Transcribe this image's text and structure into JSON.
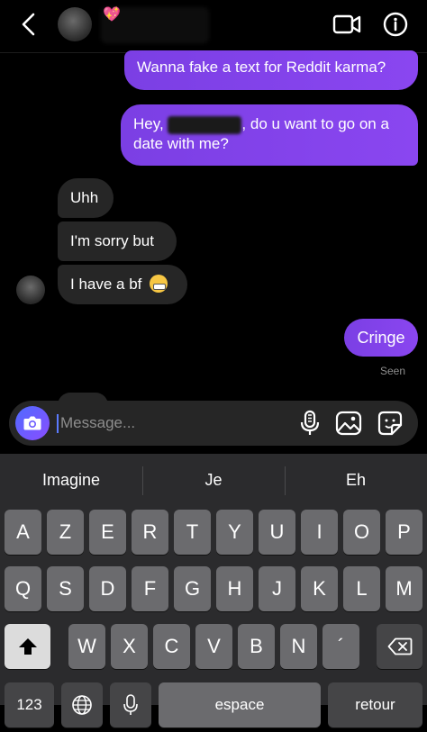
{
  "header": {
    "back_icon": "chevron-left-icon",
    "video_icon": "video-camera-icon",
    "info_icon": "info-icon"
  },
  "messages": [
    {
      "side": "sent",
      "text": "Wanna fake a text for Reddit karma?"
    },
    {
      "side": "sent",
      "text_before": "Hey, ",
      "text_after": ", do u want to go on a date with me?"
    },
    {
      "side": "received",
      "text": "Uhh"
    },
    {
      "side": "received",
      "text": "I'm sorry but"
    },
    {
      "side": "received",
      "text": "I have a bf",
      "emoji": "grimacing-face"
    },
    {
      "side": "sent",
      "text": "Cringe"
    }
  ],
  "seen_label": "Seen",
  "composer": {
    "placeholder": "Message...",
    "camera_icon": "camera-icon",
    "mic_icon": "microphone-icon",
    "gallery_icon": "image-icon",
    "sticker_icon": "sticker-icon"
  },
  "keyboard": {
    "suggestions": [
      "Imagine",
      "Je",
      "Eh"
    ],
    "row1": [
      "A",
      "Z",
      "E",
      "R",
      "T",
      "Y",
      "U",
      "I",
      "O",
      "P"
    ],
    "row2": [
      "Q",
      "S",
      "D",
      "F",
      "G",
      "H",
      "J",
      "K",
      "L",
      "M"
    ],
    "row3": [
      "W",
      "X",
      "C",
      "V",
      "B",
      "N",
      "´"
    ],
    "numbers_label": "123",
    "space_label": "espace",
    "return_label": "retour"
  },
  "colors": {
    "sent_bubble": "#7b3fe4",
    "received_bubble": "#262626",
    "background": "#000000"
  }
}
